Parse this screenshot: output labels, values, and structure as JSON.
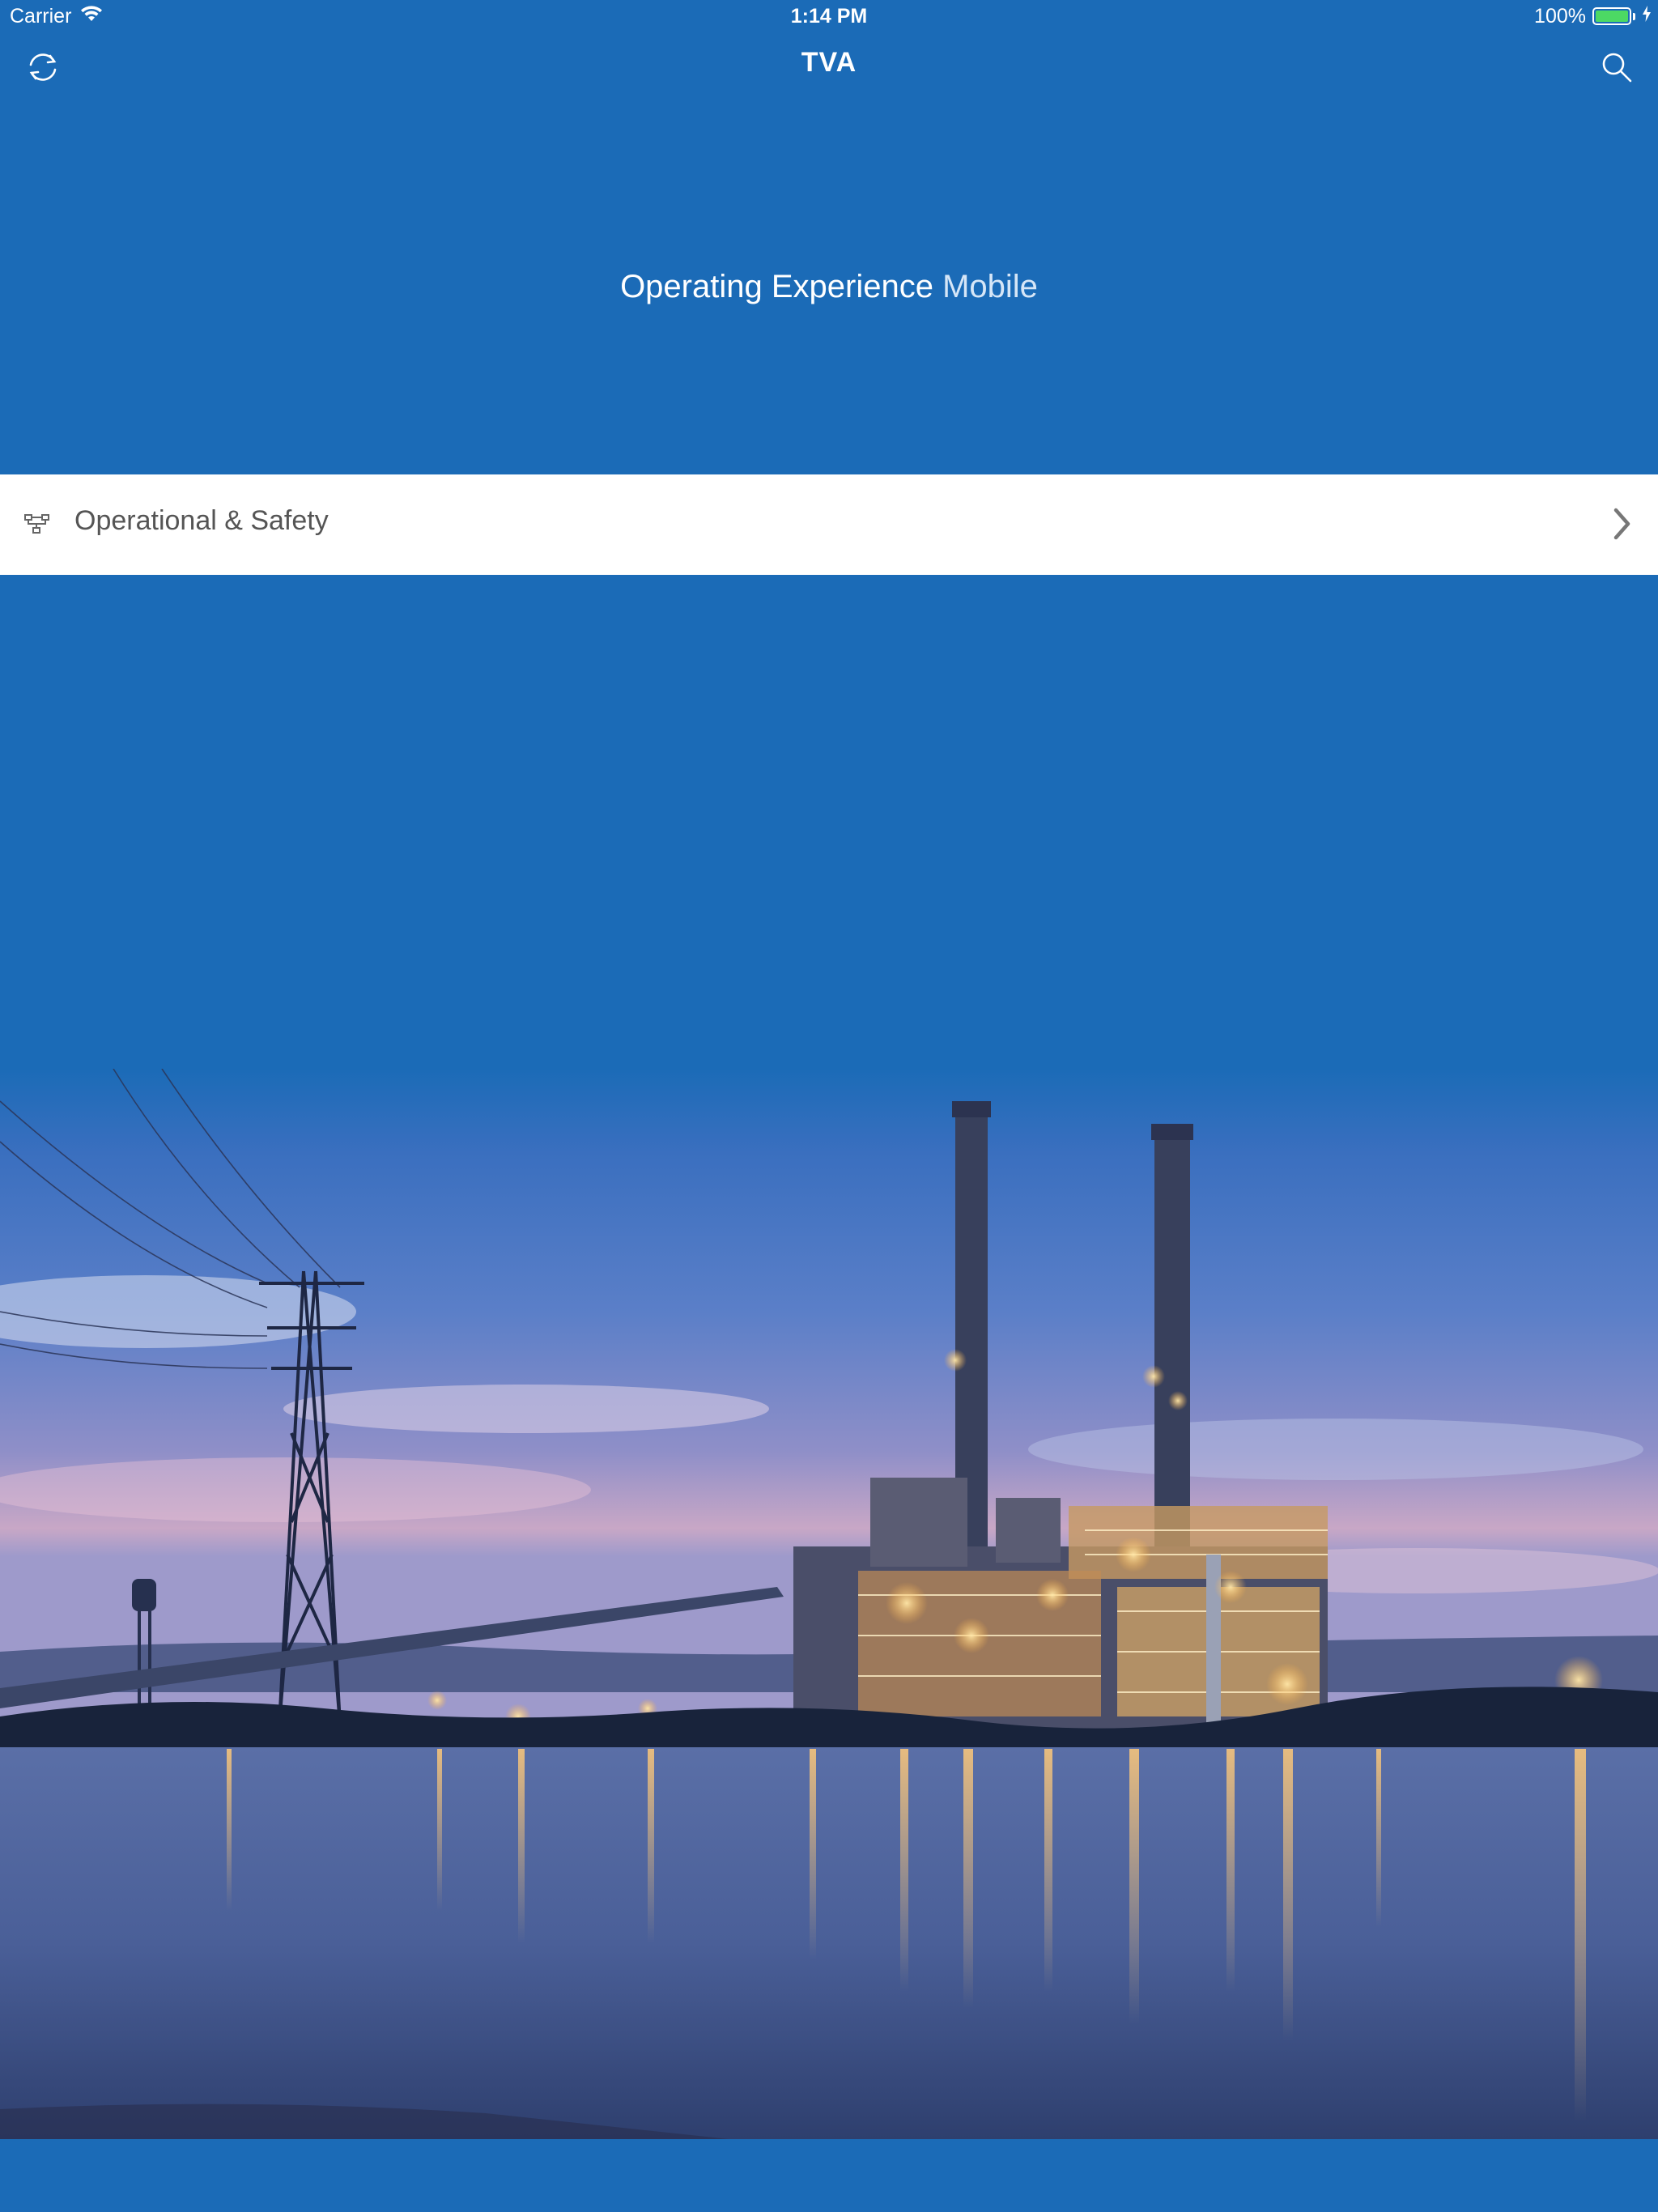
{
  "status_bar": {
    "carrier": "Carrier",
    "time": "1:14 PM",
    "battery_percent_label": "100%",
    "battery_level": 1.0
  },
  "nav": {
    "title": "TVA",
    "left_icon": "refresh-icon",
    "right_icon": "search-icon"
  },
  "heading": {
    "strong": "Operating Experience",
    "light": "Mobile"
  },
  "menu": {
    "items": [
      {
        "label": "Operational & Safety",
        "icon": "network-icon",
        "trailing_icon": "chevron-right-icon"
      }
    ]
  },
  "colors": {
    "background": "#1b6bb7",
    "row_background": "#ffffff",
    "row_text": "#555555",
    "battery_fill": "#4cd964"
  }
}
